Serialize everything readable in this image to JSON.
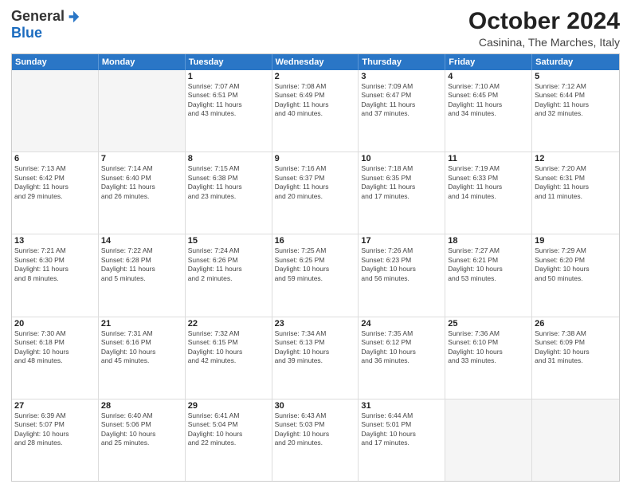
{
  "header": {
    "logo": {
      "general": "General",
      "blue": "Blue",
      "icon": "▶"
    },
    "title": "October 2024",
    "location": "Casinina, The Marches, Italy"
  },
  "calendar": {
    "days_of_week": [
      "Sunday",
      "Monday",
      "Tuesday",
      "Wednesday",
      "Thursday",
      "Friday",
      "Saturday"
    ],
    "rows": [
      [
        {
          "day": "",
          "content": ""
        },
        {
          "day": "",
          "content": ""
        },
        {
          "day": "1",
          "content": "Sunrise: 7:07 AM\nSunset: 6:51 PM\nDaylight: 11 hours\nand 43 minutes."
        },
        {
          "day": "2",
          "content": "Sunrise: 7:08 AM\nSunset: 6:49 PM\nDaylight: 11 hours\nand 40 minutes."
        },
        {
          "day": "3",
          "content": "Sunrise: 7:09 AM\nSunset: 6:47 PM\nDaylight: 11 hours\nand 37 minutes."
        },
        {
          "day": "4",
          "content": "Sunrise: 7:10 AM\nSunset: 6:45 PM\nDaylight: 11 hours\nand 34 minutes."
        },
        {
          "day": "5",
          "content": "Sunrise: 7:12 AM\nSunset: 6:44 PM\nDaylight: 11 hours\nand 32 minutes."
        }
      ],
      [
        {
          "day": "6",
          "content": "Sunrise: 7:13 AM\nSunset: 6:42 PM\nDaylight: 11 hours\nand 29 minutes."
        },
        {
          "day": "7",
          "content": "Sunrise: 7:14 AM\nSunset: 6:40 PM\nDaylight: 11 hours\nand 26 minutes."
        },
        {
          "day": "8",
          "content": "Sunrise: 7:15 AM\nSunset: 6:38 PM\nDaylight: 11 hours\nand 23 minutes."
        },
        {
          "day": "9",
          "content": "Sunrise: 7:16 AM\nSunset: 6:37 PM\nDaylight: 11 hours\nand 20 minutes."
        },
        {
          "day": "10",
          "content": "Sunrise: 7:18 AM\nSunset: 6:35 PM\nDaylight: 11 hours\nand 17 minutes."
        },
        {
          "day": "11",
          "content": "Sunrise: 7:19 AM\nSunset: 6:33 PM\nDaylight: 11 hours\nand 14 minutes."
        },
        {
          "day": "12",
          "content": "Sunrise: 7:20 AM\nSunset: 6:31 PM\nDaylight: 11 hours\nand 11 minutes."
        }
      ],
      [
        {
          "day": "13",
          "content": "Sunrise: 7:21 AM\nSunset: 6:30 PM\nDaylight: 11 hours\nand 8 minutes."
        },
        {
          "day": "14",
          "content": "Sunrise: 7:22 AM\nSunset: 6:28 PM\nDaylight: 11 hours\nand 5 minutes."
        },
        {
          "day": "15",
          "content": "Sunrise: 7:24 AM\nSunset: 6:26 PM\nDaylight: 11 hours\nand 2 minutes."
        },
        {
          "day": "16",
          "content": "Sunrise: 7:25 AM\nSunset: 6:25 PM\nDaylight: 10 hours\nand 59 minutes."
        },
        {
          "day": "17",
          "content": "Sunrise: 7:26 AM\nSunset: 6:23 PM\nDaylight: 10 hours\nand 56 minutes."
        },
        {
          "day": "18",
          "content": "Sunrise: 7:27 AM\nSunset: 6:21 PM\nDaylight: 10 hours\nand 53 minutes."
        },
        {
          "day": "19",
          "content": "Sunrise: 7:29 AM\nSunset: 6:20 PM\nDaylight: 10 hours\nand 50 minutes."
        }
      ],
      [
        {
          "day": "20",
          "content": "Sunrise: 7:30 AM\nSunset: 6:18 PM\nDaylight: 10 hours\nand 48 minutes."
        },
        {
          "day": "21",
          "content": "Sunrise: 7:31 AM\nSunset: 6:16 PM\nDaylight: 10 hours\nand 45 minutes."
        },
        {
          "day": "22",
          "content": "Sunrise: 7:32 AM\nSunset: 6:15 PM\nDaylight: 10 hours\nand 42 minutes."
        },
        {
          "day": "23",
          "content": "Sunrise: 7:34 AM\nSunset: 6:13 PM\nDaylight: 10 hours\nand 39 minutes."
        },
        {
          "day": "24",
          "content": "Sunrise: 7:35 AM\nSunset: 6:12 PM\nDaylight: 10 hours\nand 36 minutes."
        },
        {
          "day": "25",
          "content": "Sunrise: 7:36 AM\nSunset: 6:10 PM\nDaylight: 10 hours\nand 33 minutes."
        },
        {
          "day": "26",
          "content": "Sunrise: 7:38 AM\nSunset: 6:09 PM\nDaylight: 10 hours\nand 31 minutes."
        }
      ],
      [
        {
          "day": "27",
          "content": "Sunrise: 6:39 AM\nSunset: 5:07 PM\nDaylight: 10 hours\nand 28 minutes."
        },
        {
          "day": "28",
          "content": "Sunrise: 6:40 AM\nSunset: 5:06 PM\nDaylight: 10 hours\nand 25 minutes."
        },
        {
          "day": "29",
          "content": "Sunrise: 6:41 AM\nSunset: 5:04 PM\nDaylight: 10 hours\nand 22 minutes."
        },
        {
          "day": "30",
          "content": "Sunrise: 6:43 AM\nSunset: 5:03 PM\nDaylight: 10 hours\nand 20 minutes."
        },
        {
          "day": "31",
          "content": "Sunrise: 6:44 AM\nSunset: 5:01 PM\nDaylight: 10 hours\nand 17 minutes."
        },
        {
          "day": "",
          "content": ""
        },
        {
          "day": "",
          "content": ""
        }
      ]
    ]
  }
}
